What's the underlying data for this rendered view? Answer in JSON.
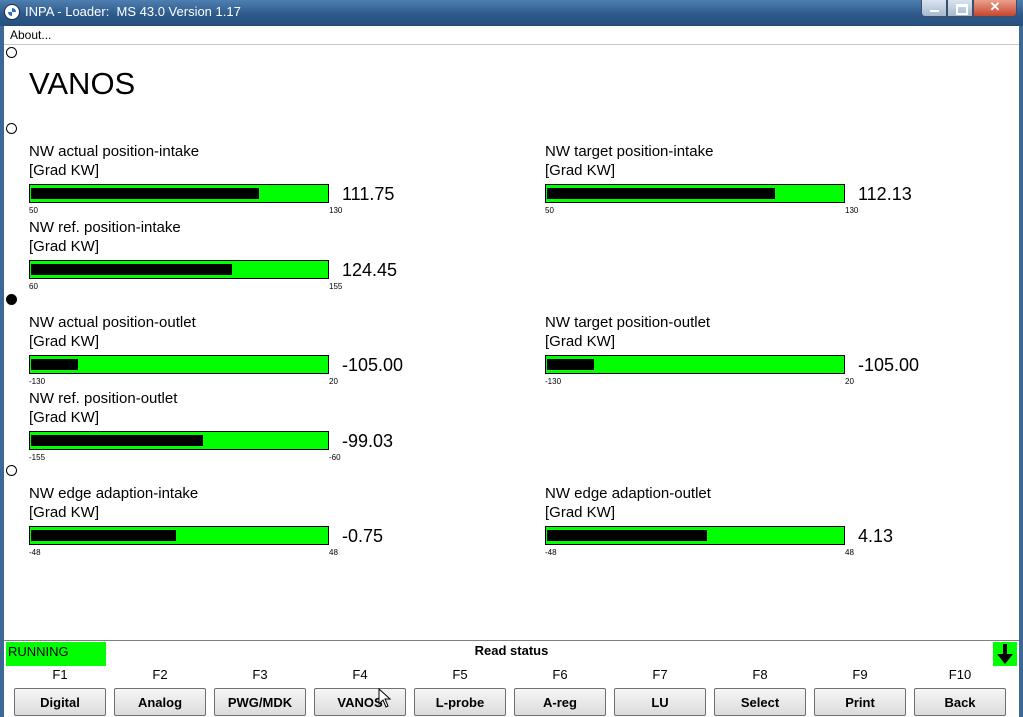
{
  "window": {
    "title": "INPA - Loader:  MS 43.0 Version 1.17",
    "app_icon": "bmw-logo-icon"
  },
  "menu": {
    "about": "About..."
  },
  "page": {
    "title": "VANOS"
  },
  "colors": {
    "bar_background": "#00ff00",
    "bar_fill": "#000000",
    "status": "#00ff00"
  },
  "gauges": [
    {
      "label": "NW actual position-intake",
      "unit": "[Grad KW]",
      "value": "111.75",
      "min": "50",
      "max": "130",
      "fraction": 0.77
    },
    {
      "label": "NW target position-intake",
      "unit": "[Grad KW]",
      "value": "112.13",
      "min": "50",
      "max": "130",
      "fraction": 0.77
    },
    {
      "label": "NW ref. position-intake",
      "unit": "[Grad KW]",
      "value": "124.45",
      "min": "60",
      "max": "155",
      "fraction": 0.68
    },
    {
      "label": "NW actual position-outlet",
      "unit": "[Grad KW]",
      "value": "-105.00",
      "min": "-130",
      "max": "20",
      "fraction": 0.16
    },
    {
      "label": "NW target position-outlet",
      "unit": "[Grad KW]",
      "value": "-105.00",
      "min": "-130",
      "max": "20",
      "fraction": 0.16
    },
    {
      "label": "NW ref. position-outlet",
      "unit": "[Grad KW]",
      "value": "-99.03",
      "min": "-155",
      "max": "-60",
      "fraction": 0.58
    },
    {
      "label": "NW edge adaption-intake",
      "unit": "[Grad KW]",
      "value": "-0.75",
      "min": "-48",
      "max": "48",
      "fraction": 0.49
    },
    {
      "label": "NW edge adaption-outlet",
      "unit": "[Grad KW]",
      "value": "4.13",
      "min": "-48",
      "max": "48",
      "fraction": 0.54
    }
  ],
  "status": {
    "state": "RUNNING",
    "message": "Read status"
  },
  "function_keys": [
    {
      "key": "F1",
      "label": "Digital"
    },
    {
      "key": "F2",
      "label": "Analog"
    },
    {
      "key": "F3",
      "label": "PWG/MDK"
    },
    {
      "key": "F4",
      "label": "VANOS"
    },
    {
      "key": "F5",
      "label": "L-probe"
    },
    {
      "key": "F6",
      "label": "A-reg"
    },
    {
      "key": "F7",
      "label": "LU"
    },
    {
      "key": "F8",
      "label": "Select"
    },
    {
      "key": "F9",
      "label": "Print"
    },
    {
      "key": "F10",
      "label": "Back"
    }
  ]
}
